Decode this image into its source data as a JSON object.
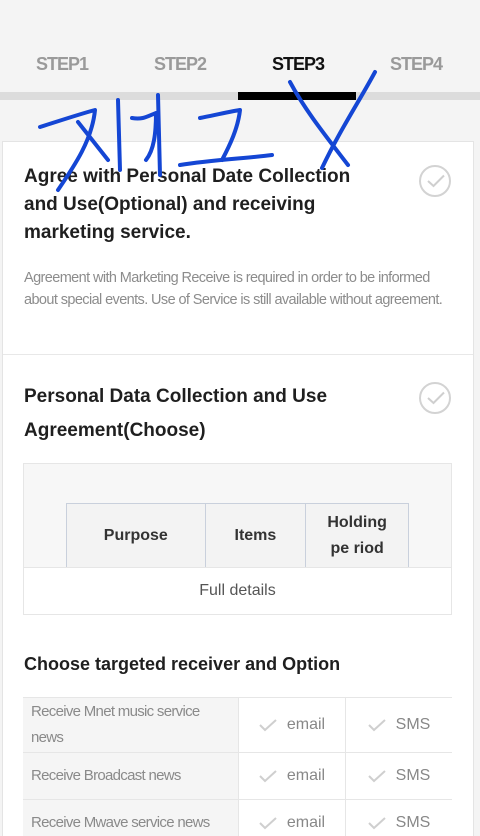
{
  "steps": [
    {
      "label": "STEP1",
      "active": false
    },
    {
      "label": "STEP2",
      "active": false
    },
    {
      "label": "STEP3",
      "active": true
    },
    {
      "label": "STEP4",
      "active": false
    }
  ],
  "section1": {
    "title": "Agree with Personal Date Collection and Use(Optional) and receiving marketing service.",
    "description": "Agreement with Marketing Receive is required in order to be informed about special events. Use of Service is still available without agreement."
  },
  "section2": {
    "title": "Personal Data Collection and Use Agreement(Choose)",
    "table_headers": [
      "Purpose",
      "Items",
      "Holding pe riod"
    ],
    "full_details": "Full details"
  },
  "section3": {
    "title": "Choose targeted receiver and Option",
    "rows": [
      {
        "label": "Receive Mnet music service news",
        "email": "email",
        "sms": "SMS"
      },
      {
        "label": "Receive Broadcast news",
        "email": "email",
        "sms": "SMS"
      },
      {
        "label": "Receive Mwave service news",
        "email": "email",
        "sms": "SMS"
      }
    ]
  },
  "colors": {
    "active_step": "#111111",
    "inactive_step": "#9a9a9a",
    "progress_fill": "#000000",
    "scribble_ink": "#1446d4"
  }
}
